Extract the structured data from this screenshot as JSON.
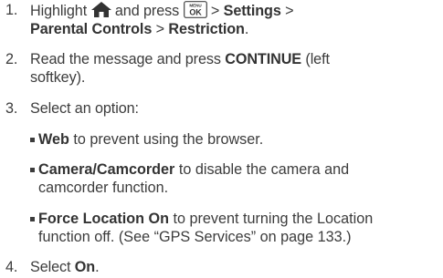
{
  "steps": [
    {
      "number": "1.",
      "lead": "Highlight",
      "home_icon": "home-icon",
      "mid": "and press",
      "menu_key": {
        "top": "MENU",
        "bottom": "OK"
      },
      "sep1": " > ",
      "path_settings": "Settings",
      "sep2": " >",
      "path_parental": "Parental Controls",
      "sep3": " > ",
      "path_restriction": "Restriction",
      "end": "."
    },
    {
      "number": "2.",
      "pre": "Read the message and press ",
      "bold": "CONTINUE",
      "post": " (left",
      "line2": "softkey)."
    },
    {
      "number": "3.",
      "text": "Select an option:"
    },
    {
      "number": "4.",
      "pre": "Select ",
      "bold": "On",
      "post": "."
    }
  ],
  "options": [
    {
      "bold": "Web",
      "rest": " to prevent using the browser."
    },
    {
      "bold": "Camera/Camcorder",
      "rest": " to disable the camera and",
      "line2": "camcorder function."
    },
    {
      "bold": "Force Location On",
      "rest": " to prevent turning the Location",
      "line2": "function off. (See “GPS Services” on page 133.)"
    }
  ],
  "colors": {
    "text": "#3c3c3c"
  }
}
